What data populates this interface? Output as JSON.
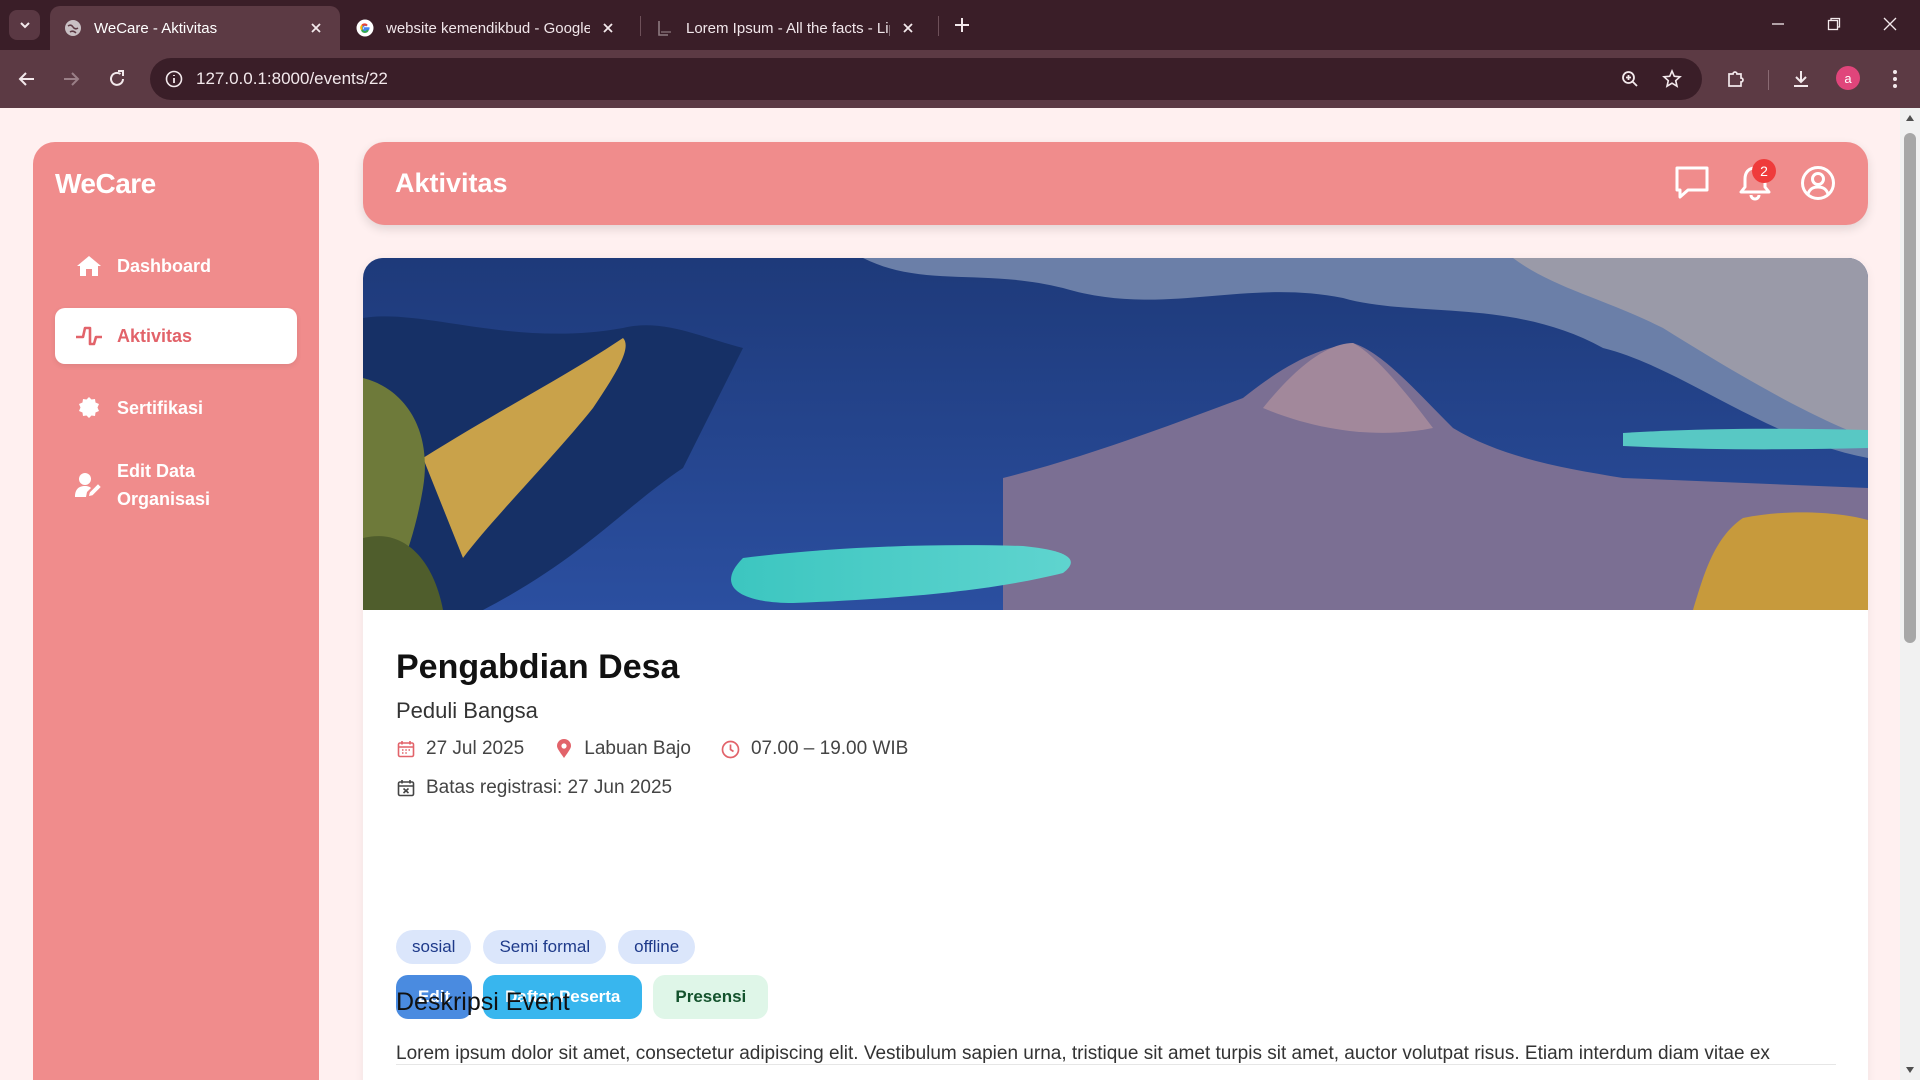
{
  "browser": {
    "tabs": [
      {
        "title": "WeCare - Aktivitas",
        "active": true
      },
      {
        "title": "website kemendikbud - Google",
        "active": false
      },
      {
        "title": "Lorem Ipsum - All the facts - Lip",
        "active": false
      }
    ],
    "url": "127.0.0.1:8000/events/22",
    "profile_initial": "a"
  },
  "sidebar": {
    "brand": "WeCare",
    "items": [
      {
        "label": "Dashboard",
        "icon": "home-icon",
        "active": false
      },
      {
        "label": "Aktivitas",
        "icon": "activity-icon",
        "active": true
      },
      {
        "label": "Sertifikasi",
        "icon": "certificate-icon",
        "active": false
      },
      {
        "label": "Edit Data Organisasi",
        "icon": "user-edit-icon",
        "active": false
      }
    ]
  },
  "header": {
    "title": "Aktivitas",
    "notification_count": "2",
    "icons": [
      "chat-icon",
      "bell-icon",
      "user-circle-icon"
    ]
  },
  "event": {
    "title": "Pengabdian Desa",
    "organizer": "Peduli Bangsa",
    "date": "27 Jul 2025",
    "location": "Labuan Bajo",
    "time": "07.00 – 19.00 WIB",
    "registration_deadline": "Batas registrasi: 27 Jun 2025",
    "tags": [
      "sosial",
      "Semi formal",
      "offline"
    ],
    "buttons": {
      "edit": "Edit",
      "participants": "Daftar Peserta",
      "attendance": "Presensi"
    },
    "description_title": "Deskripsi Event",
    "description": "Lorem ipsum dolor sit amet, consectetur adipiscing elit. Vestibulum sapien urna, tristique sit amet turpis sit amet, auctor volutpat risus. Etiam interdum diam vitae ex"
  },
  "colors": {
    "sidebar": "#f08c8c",
    "accent": "#e2636a",
    "page_bg": "#fff0f0",
    "tag_bg": "#dbe6fb",
    "edit_button": "#4a8be0",
    "participants_button": "#38b6ee",
    "attendance_button": "#dff6e8"
  }
}
